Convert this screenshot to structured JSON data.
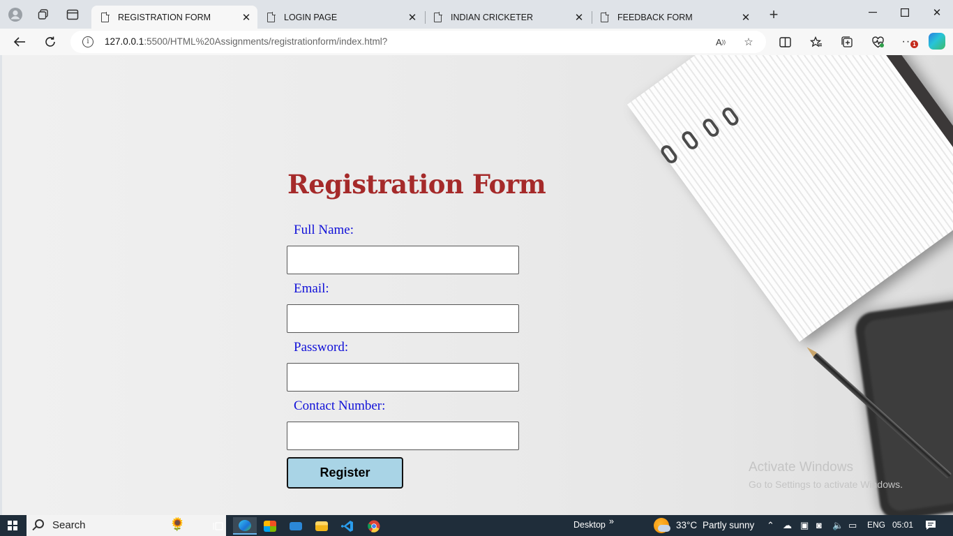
{
  "browser": {
    "tabs": [
      {
        "label": "REGISTRATION FORM",
        "active": true
      },
      {
        "label": "LOGIN PAGE",
        "active": false
      },
      {
        "label": "INDIAN CRICKETER",
        "active": false
      },
      {
        "label": "FEEDBACK FORM",
        "active": false
      }
    ],
    "url_host": "127.0.0.1",
    "url_rest": ":5500/HTML%20Assignments/registrationform/index.html?",
    "notification_count": "1",
    "icons": {
      "profile": "profile-icon",
      "workspaces": "workspaces-icon",
      "tab_actions": "tab-actions-icon",
      "new_tab": "plus-icon",
      "back": "back-arrow-icon",
      "refresh": "refresh-icon",
      "read_aloud": "read-aloud-icon",
      "favorite": "star-icon",
      "split_screen": "split-screen-icon",
      "favorites": "favorites-icon",
      "collections": "collections-icon",
      "performance": "heart-pulse-icon",
      "more": "more-icon",
      "copilot": "copilot-icon"
    }
  },
  "page": {
    "title": "Registration Form",
    "fields": [
      {
        "label": "Full Name:",
        "value": "",
        "type": "text"
      },
      {
        "label": "Email:",
        "value": "",
        "type": "email"
      },
      {
        "label": "Password:",
        "value": "",
        "type": "password"
      },
      {
        "label": "Contact Number:",
        "value": "",
        "type": "tel"
      }
    ],
    "register_label": "Register",
    "colors": {
      "title": "#a52a2a",
      "labels": "#1010d8",
      "button_bg": "#a9d4e6"
    }
  },
  "watermark": {
    "line1": "Activate Windows",
    "line2": "Go to Settings to activate Windows."
  },
  "taskbar": {
    "search_label": "Search",
    "desktop_label": "Desktop",
    "desktop_chevron": "»",
    "weather_temp": "33°C",
    "weather_desc": "Partly sunny",
    "language": "ENG",
    "time": "05:01",
    "apps": [
      "task-view-icon",
      "edge-icon",
      "store-icon",
      "mail-icon",
      "file-explorer-icon",
      "vscode-icon",
      "chrome-icon"
    ]
  }
}
